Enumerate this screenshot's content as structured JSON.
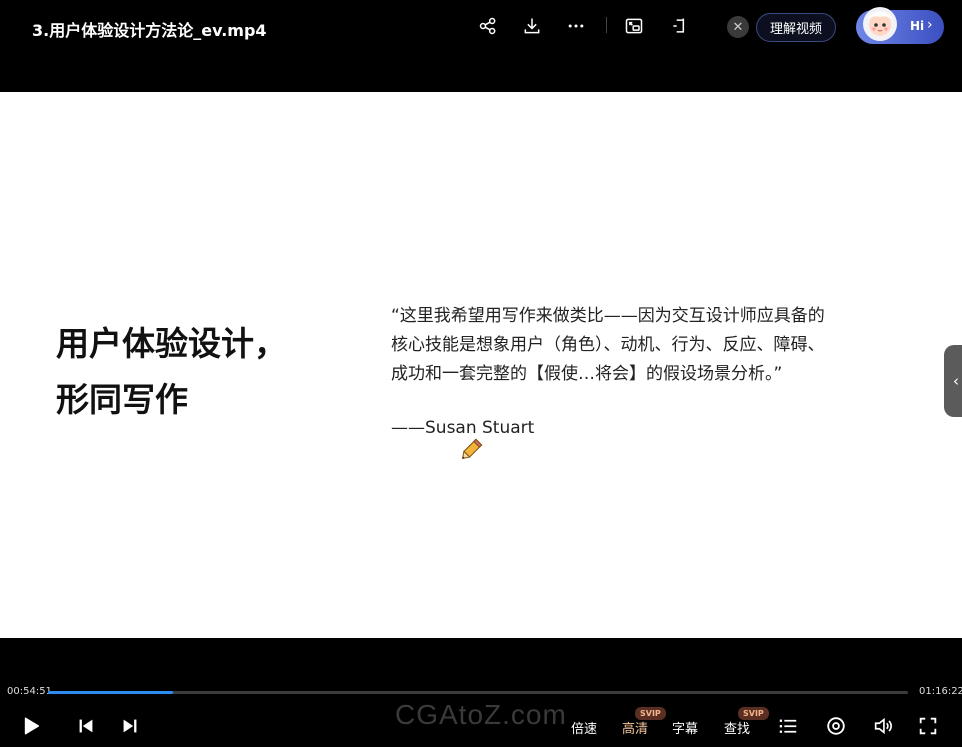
{
  "header": {
    "file_title": "3.用户体验设计方法论_ev.mp4",
    "understand_label": "理解视频",
    "hi_label": "Hi",
    "close_symbol": "✕"
  },
  "icons": {
    "share": "share-icon",
    "download": "download-icon",
    "more": "more-icon",
    "picture_in_picture": "picture-in-picture-icon",
    "mini_window": "mini-window-icon"
  },
  "slide": {
    "heading_lines": [
      "用户体验设计，",
      "形同写作"
    ],
    "quote_lines": [
      "“这里我希望用写作来做类比——因为交互设计师应具备的",
      "核心技能是想象用户（角色）、动机、行为、反应、障碍、",
      "成功和一套完整的【假使…将会】的假设场景分析。”"
    ],
    "author": "——Susan Stuart"
  },
  "player": {
    "current_time": "00:54:51",
    "total_time": "01:16:22",
    "progress_fraction": 0.145,
    "speed_label": "倍速",
    "quality_label": "高清",
    "subtitle_label": "字幕",
    "search_label": "查找",
    "badge_label": "SVIP",
    "watermark": "CGAtoZ.com"
  },
  "colors": {
    "progress": "#2d8cf0",
    "accent": "#f5c69b"
  }
}
